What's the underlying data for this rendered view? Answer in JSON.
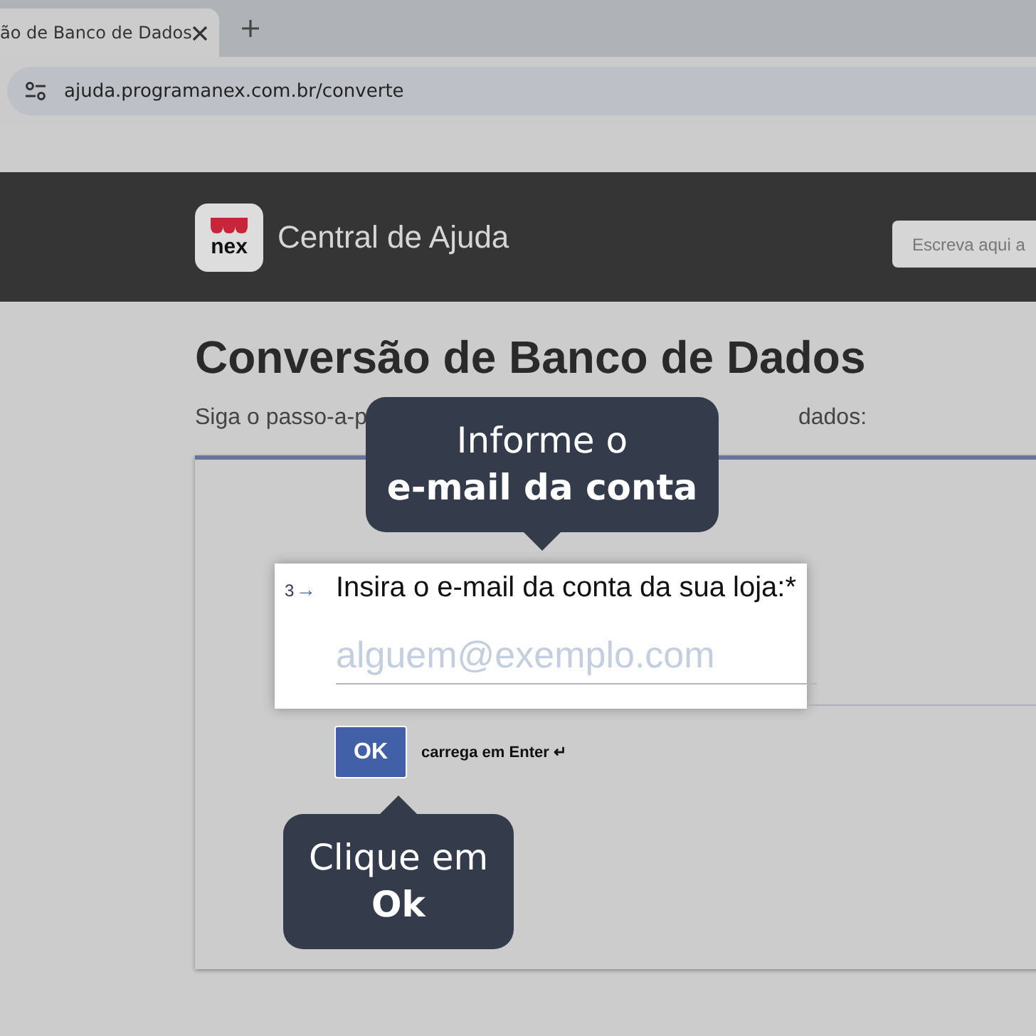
{
  "browser": {
    "tab": {
      "title": "ão de Banco de Dados",
      "selected": true
    },
    "url": "ajuda.programanex.com.br/converte"
  },
  "header": {
    "logo_text": "nex",
    "title": "Central de Ajuda",
    "search": {
      "placeholder": "Escreva aqui a"
    }
  },
  "page": {
    "title": "Conversão de Banco de Dados",
    "subtitle_parts": [
      "Siga o passo-a-p",
      "dados:"
    ]
  },
  "question": {
    "number": "3",
    "arrow": "→",
    "label": "Insira o e-mail da conta da sua loja:*",
    "placeholder": "alguem@exemplo.com"
  },
  "ok_button": {
    "label": "OK",
    "hint": "carrega em Enter ↵"
  },
  "callouts": [
    {
      "kind": "down",
      "lines": [
        "Informe o",
        "**e-mail da conta**"
      ]
    },
    {
      "kind": "up",
      "lines": [
        "Clique em",
        "**Ok**"
      ]
    }
  ]
}
